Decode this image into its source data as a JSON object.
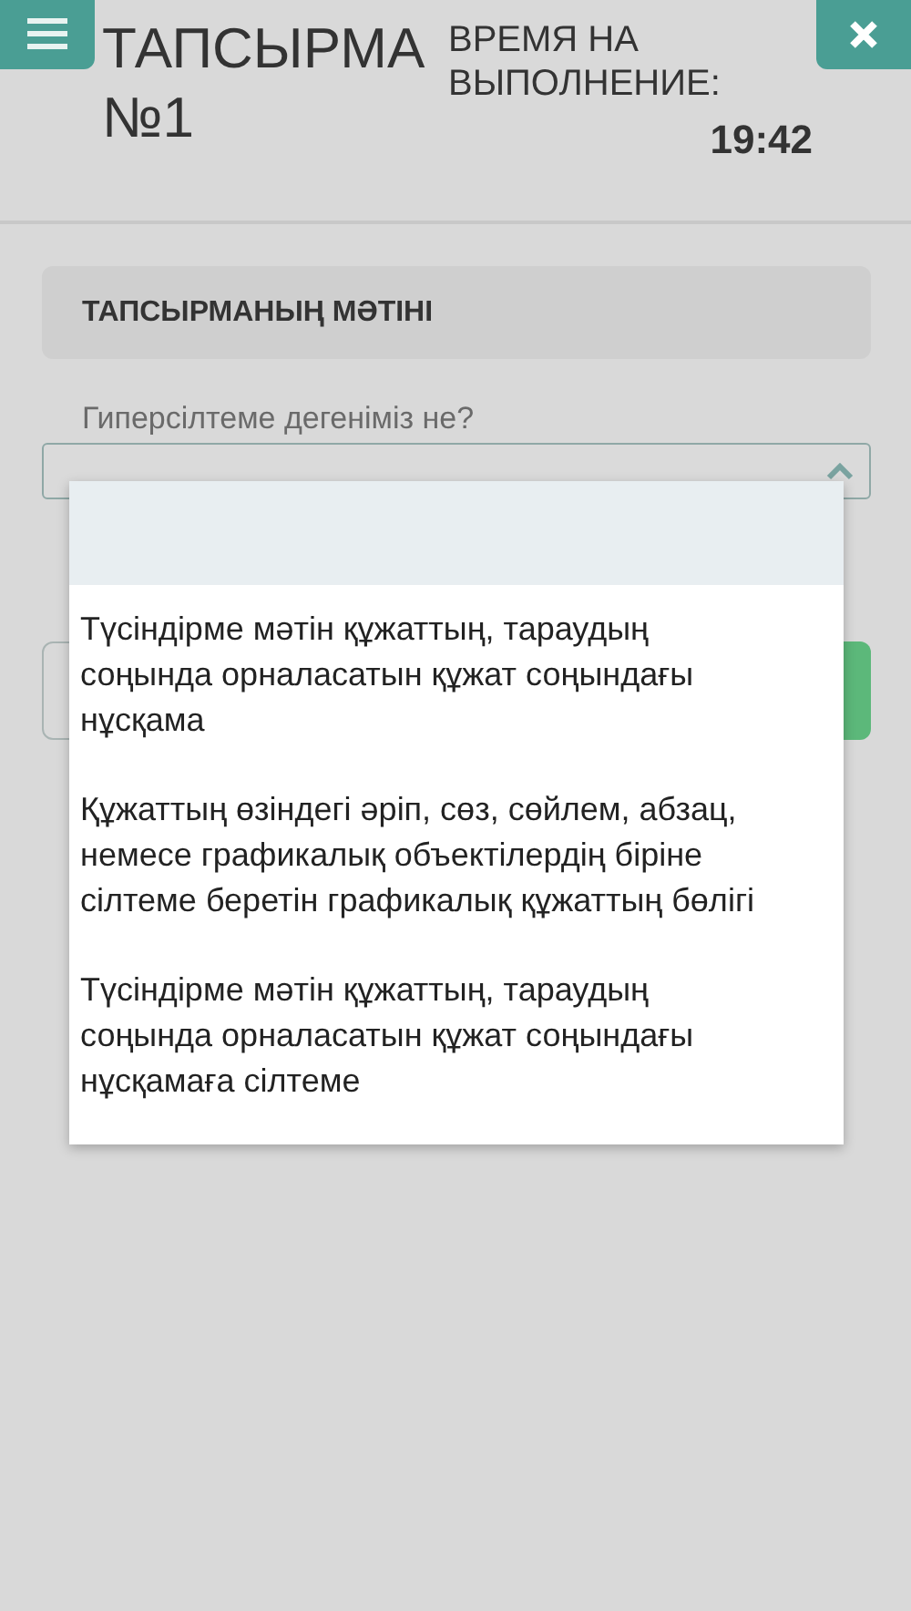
{
  "header": {
    "title": "ТАПСЫРМА №1",
    "timer_label": "ВРЕМЯ НА ВЫПОЛНЕНИЕ:",
    "timer_value": "19:42"
  },
  "section": {
    "heading": "ТАПСЫРМАНЫҢ МӘТІНІ"
  },
  "question": {
    "text": "Гиперсілтеме дегеніміз не?",
    "expanded": true,
    "blank_option_selected": true,
    "options": [
      {
        "text": "Түсіндірме мәтін құжаттың, тараудың соңында орналасатын құжат соңындағы нұсқама",
        "selected": false
      },
      {
        "text": "Құжаттың өзіндегі әріп, сөз, сөйлем, абзац, немесе графикалық объектілердің біріне сілтеме беретін графикалық құжаттың бөлігі",
        "selected": false
      },
      {
        "text": "Түсіндірме мәтін құжаттың, тараудың соңында орналасатын құжат соңындағы нұсқамаға сілтеме",
        "selected": false
      }
    ]
  }
}
